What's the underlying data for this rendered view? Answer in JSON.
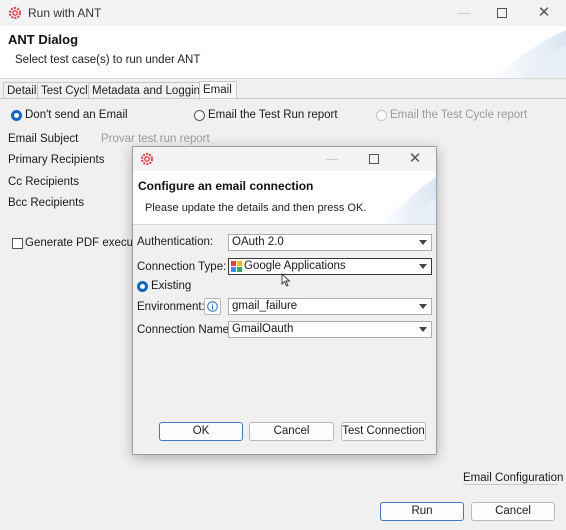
{
  "window": {
    "title": "Run with ANT"
  },
  "header": {
    "title": "ANT Dialog",
    "subtitle": "Select test case(s) to run under ANT"
  },
  "tabs": [
    {
      "label": "Detail"
    },
    {
      "label": "Test Cycle"
    },
    {
      "label": "Metadata and Logging"
    },
    {
      "label": "Email"
    }
  ],
  "email_options": {
    "dont_send": "Don't send an Email",
    "test_run_report": "Email the Test Run report",
    "test_cycle_report": "Email the Test Cycle report"
  },
  "form": {
    "email_subject_label": "Email Subject",
    "email_subject_placeholder": "Provar test run report",
    "primary_recipients_label": "Primary Recipients",
    "cc_recipients_label": "Cc Recipients",
    "bcc_recipients_label": "Bcc Recipients",
    "generate_pdf_label": "Generate PDF executio",
    "email_configuration_label": "Email Configuration"
  },
  "footer": {
    "run_label": "Run",
    "cancel_label": "Cancel"
  },
  "modal": {
    "title": "Configure an email connection",
    "subtitle": "Please update the details and then press OK.",
    "authentication_label": "Authentication:",
    "authentication_value": "OAuth 2.0",
    "connection_type_label": "Connection Type:",
    "connection_type_value": "Google Applications",
    "existing_label": "Existing",
    "environment_label": "Environment:",
    "environment_value": "gmail_failure",
    "connection_name_label": "Connection Name:",
    "connection_name_value": "GmailOauth",
    "ok_label": "OK",
    "cancel_label": "Cancel",
    "test_connection_label": "Test Connection"
  },
  "icons": {
    "app": "gear-icon",
    "minimize": "minimize-icon",
    "maximize": "maximize-icon",
    "close": "close-icon",
    "info": "info-icon",
    "google": "google-icon"
  },
  "colors": {
    "accent": "#1565c0",
    "header_bg": "#ffffff",
    "window_bg": "#f0f0f0"
  }
}
